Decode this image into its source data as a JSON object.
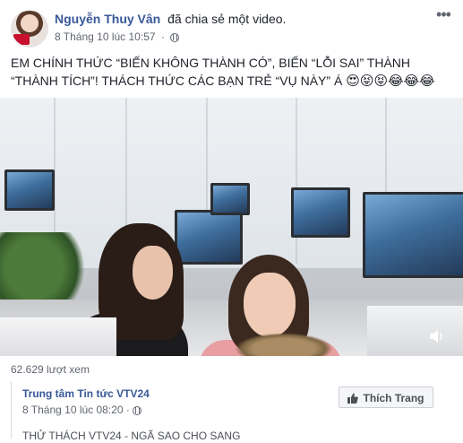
{
  "post": {
    "author": "Nguyễn Thuy Vân",
    "action": "đã chia sẻ một video.",
    "timestamp": "8 Tháng 10 lúc 10:57",
    "separator": "·",
    "privacy_icon": "globe-icon",
    "more_icon": "more-horizontal-icon",
    "text_line1": "EM CHÍNH THỨC “BIẾN KHÔNG THÀNH CÓ”, BIẾN “LỖI SAI” THÀNH",
    "text_line2": "“THÀNH TÍCH”! THÁCH THỨC CÁC BẠN TRẺ “VỤ NÀY” Á",
    "emojis": "😍😝😝😂😂😂"
  },
  "video": {
    "views": "62.629 lượt xem",
    "volume_icon": "speaker-icon"
  },
  "shared_page": {
    "name": "Trung tâm Tin tức VTV24",
    "timestamp": "8 Tháng 10 lúc 08:20",
    "like_button_label": "Thích Trang",
    "like_icon": "thumbs-up-icon",
    "video_title": "THỬ THÁCH VTV24 - NGÃ SAO CHO SANG"
  },
  "colors": {
    "link": "#385898",
    "meta": "#616770",
    "text": "#1d2129"
  }
}
